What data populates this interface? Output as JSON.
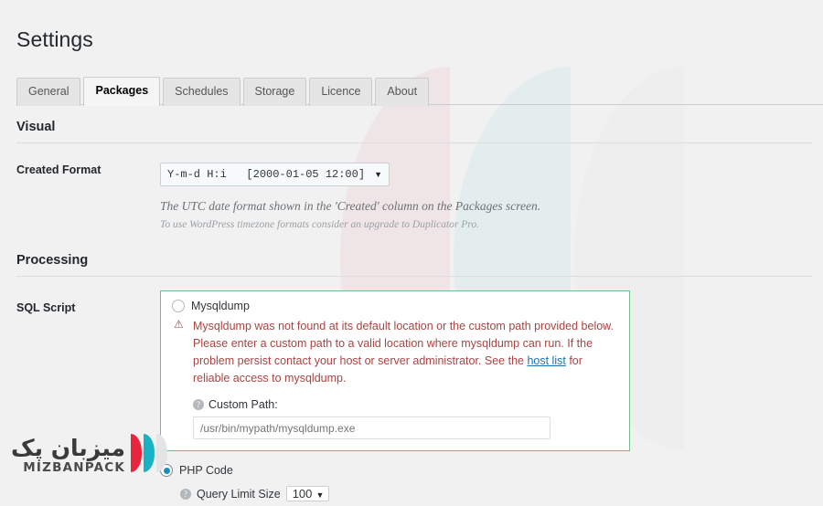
{
  "page": {
    "title": "Settings"
  },
  "tabs": [
    {
      "label": "General",
      "active": false
    },
    {
      "label": "Packages",
      "active": true
    },
    {
      "label": "Schedules",
      "active": false
    },
    {
      "label": "Storage",
      "active": false
    },
    {
      "label": "Licence",
      "active": false
    },
    {
      "label": "About",
      "active": false
    }
  ],
  "visual": {
    "heading": "Visual",
    "created_format": {
      "label": "Created Format",
      "value": "Y-m-d H:i   [2000-01-05 12:00]",
      "caret": "▼",
      "options": [
        "Y-m-d H:i   [2000-01-05 12:00]"
      ],
      "description": "The UTC date format shown in the 'Created' column on the Packages screen.",
      "subnote": "To use WordPress timezone formats consider an upgrade to Duplicator Pro."
    }
  },
  "processing": {
    "heading": "Processing",
    "sql_script": {
      "label": "SQL Script",
      "mysqldump": {
        "radio_label": "Mysqldump",
        "selected": false,
        "error_icon": "⚠",
        "error_text_part1": "Mysqldump was not found at its default location or the custom path provided below. Please enter a custom path to a valid location where mysqldump can run. If the problem persist contact your host or server administrator. See the ",
        "error_link": "host list",
        "error_text_part2": " for reliable access to mysqldump.",
        "custom_path": {
          "help_icon": "?",
          "label": "Custom Path:",
          "value": "",
          "placeholder": "/usr/bin/mypath/mysqldump.exe"
        }
      },
      "php_code": {
        "radio_label": "PHP Code",
        "selected": true,
        "query_limit": {
          "help_icon": "?",
          "label": "Query Limit Size",
          "value": "100",
          "caret": "▼",
          "options": [
            "100"
          ]
        }
      }
    }
  },
  "watermark_logo": {
    "persian": "میزبان پک",
    "latin": "MIZBANPACK"
  },
  "colors": {
    "accent_blue": "#1e8cbe",
    "error_red": "#a94442",
    "link_blue": "#2271b1",
    "success_green": "#73bd8b",
    "logo_red": "#e8243f",
    "logo_teal": "#17b3c4",
    "logo_gray": "#e2e4e5",
    "page_bg": "#f1f1f1"
  }
}
